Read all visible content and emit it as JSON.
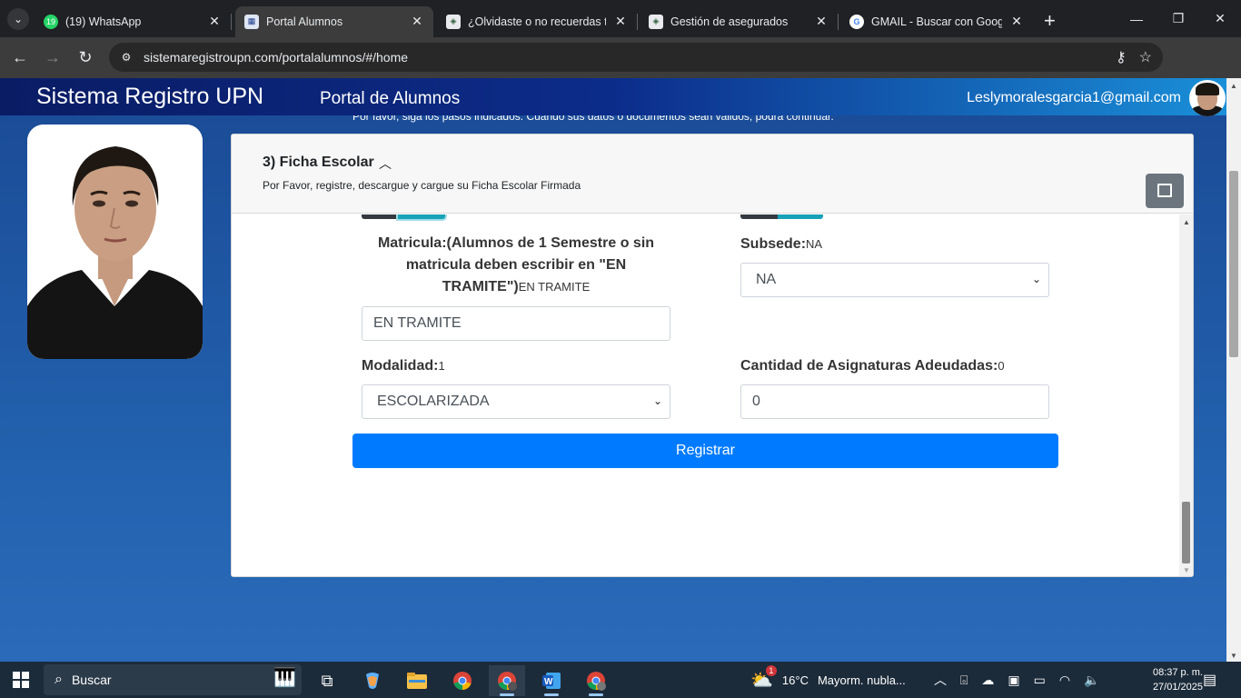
{
  "browser": {
    "tabs": [
      {
        "title": "(19) WhatsApp",
        "badge": "19",
        "active": false
      },
      {
        "title": "Portal Alumnos",
        "active": true
      },
      {
        "title": "¿Olvidaste o no recuerdas tu",
        "active": false
      },
      {
        "title": "Gestión de asegurados",
        "active": false
      },
      {
        "title": "GMAIL - Buscar con Google",
        "active": false
      }
    ],
    "url": "sistemaregistroupn.com/portalalumnos/#/home"
  },
  "header": {
    "site_title": "Sistema Registro UPN",
    "portal_title": "Portal de Alumnos",
    "user_email": "Leslymoralesgarcia1@gmail.com"
  },
  "notice": "Por favor, siga los pasos indicados. Cuando sus datos o documentos sean válidos, podrá continuar.",
  "panel": {
    "title": "3) Ficha Escolar",
    "subtitle": "Por Favor, registre, descargue y cargue su Ficha Escolar Firmada",
    "fields": {
      "matricula": {
        "label": "Matricula:(Alumnos de 1 Semestre o sin matricula deben escribir en \"EN TRAMITE\")",
        "current": "EN TRAMITE",
        "value": "EN TRAMITE"
      },
      "subsede": {
        "label": "Subsede:",
        "current": "NA",
        "value": "NA"
      },
      "modalidad": {
        "label": "Modalidad:",
        "current": "1",
        "value": "ESCOLARIZADA"
      },
      "asignaturas": {
        "label": "Cantidad de Asignaturas Adeudadas:",
        "current": "0",
        "value": "0"
      }
    },
    "submit_label": "Registrar"
  },
  "taskbar": {
    "search_placeholder": "Buscar",
    "weather": {
      "temp": "16°C",
      "desc": "Mayorm. nubla...",
      "badge": "1"
    },
    "time": "08:37 p. m.",
    "date": "27/01/2025"
  },
  "colors": {
    "primary": "#007bff",
    "header_dark": "#0a1c64",
    "header_light": "#1a8fd8",
    "page_bg": "#1e4f9c"
  }
}
